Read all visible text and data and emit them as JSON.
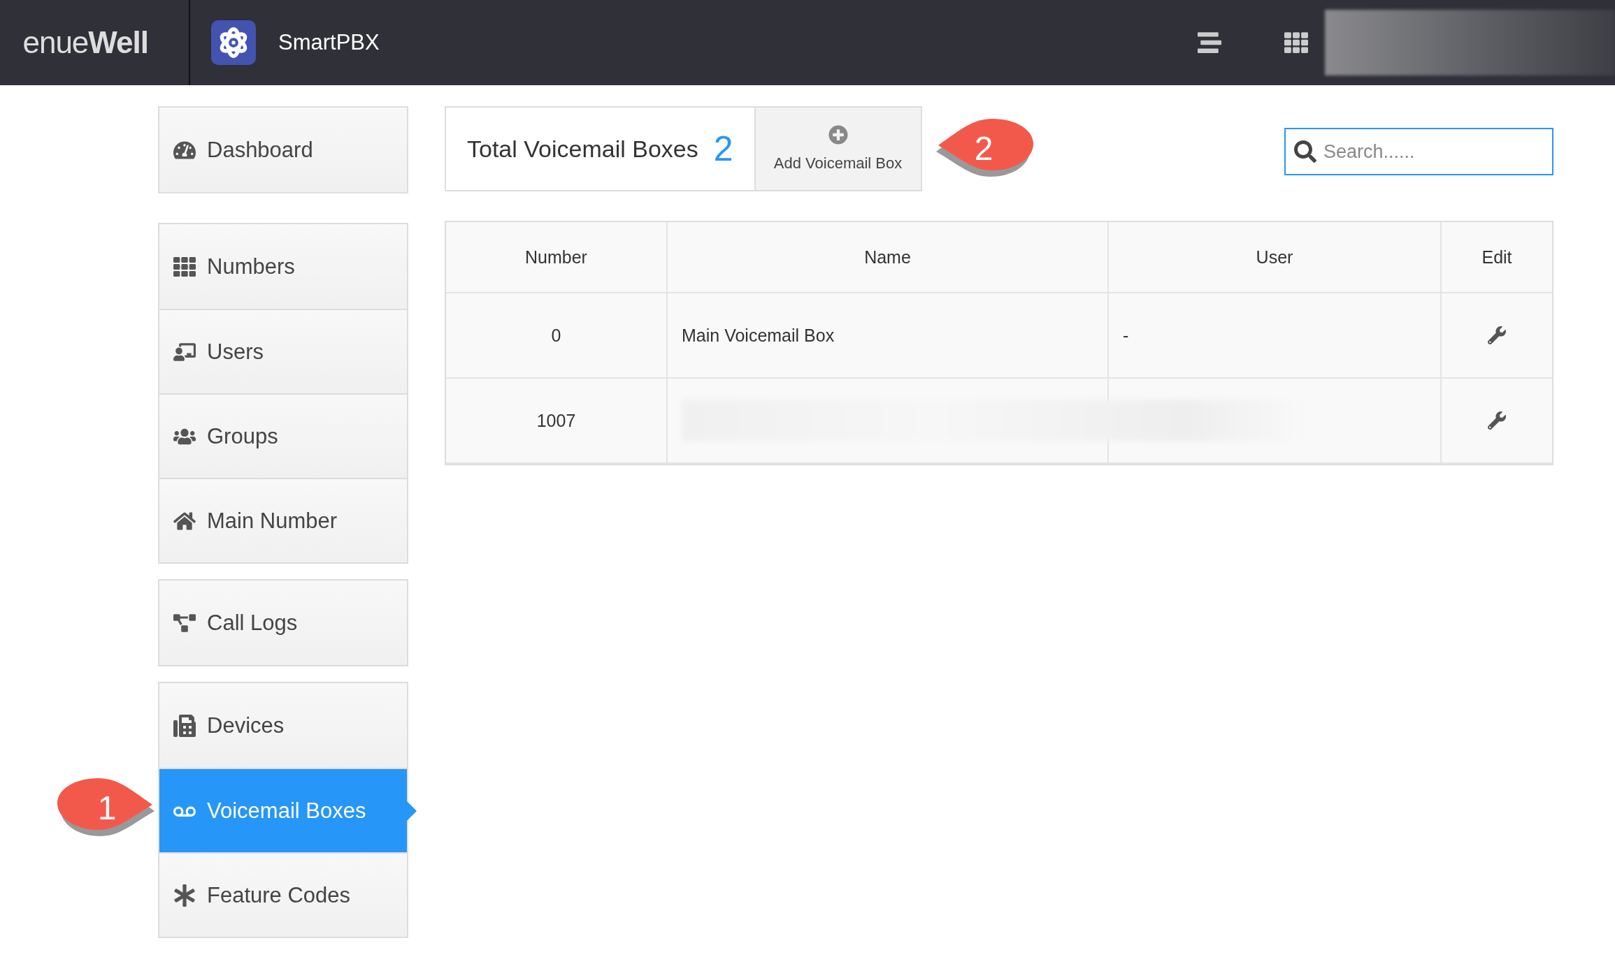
{
  "header": {
    "brand": "enue**Well**",
    "app_name": "SmartPBX"
  },
  "sidebar": {
    "groups": [
      {
        "items": [
          {
            "label": "Dashboard",
            "selected": false
          }
        ]
      },
      {
        "items": [
          {
            "label": "Numbers",
            "selected": false
          },
          {
            "label": "Users",
            "selected": false
          },
          {
            "label": "Groups",
            "selected": false
          },
          {
            "label": "Main Number",
            "selected": false
          }
        ]
      },
      {
        "items": [
          {
            "label": "Call Logs",
            "selected": false
          }
        ]
      },
      {
        "items": [
          {
            "label": "Devices",
            "selected": false
          },
          {
            "label": "Voicemail Boxes",
            "selected": true
          },
          {
            "label": "Feature Codes",
            "selected": false
          }
        ]
      }
    ]
  },
  "summary": {
    "label": "Total Voicemail Boxes",
    "count": "2",
    "add_button": "Add Voicemail Box"
  },
  "search": {
    "placeholder": "Search......"
  },
  "table": {
    "columns": [
      "Number",
      "Name",
      "User",
      "Edit"
    ],
    "rows": [
      {
        "number": "0",
        "name": "Main Voicemail Box",
        "user": "-"
      },
      {
        "number": "1007"
      }
    ]
  },
  "callouts": [
    "1",
    "2"
  ]
}
